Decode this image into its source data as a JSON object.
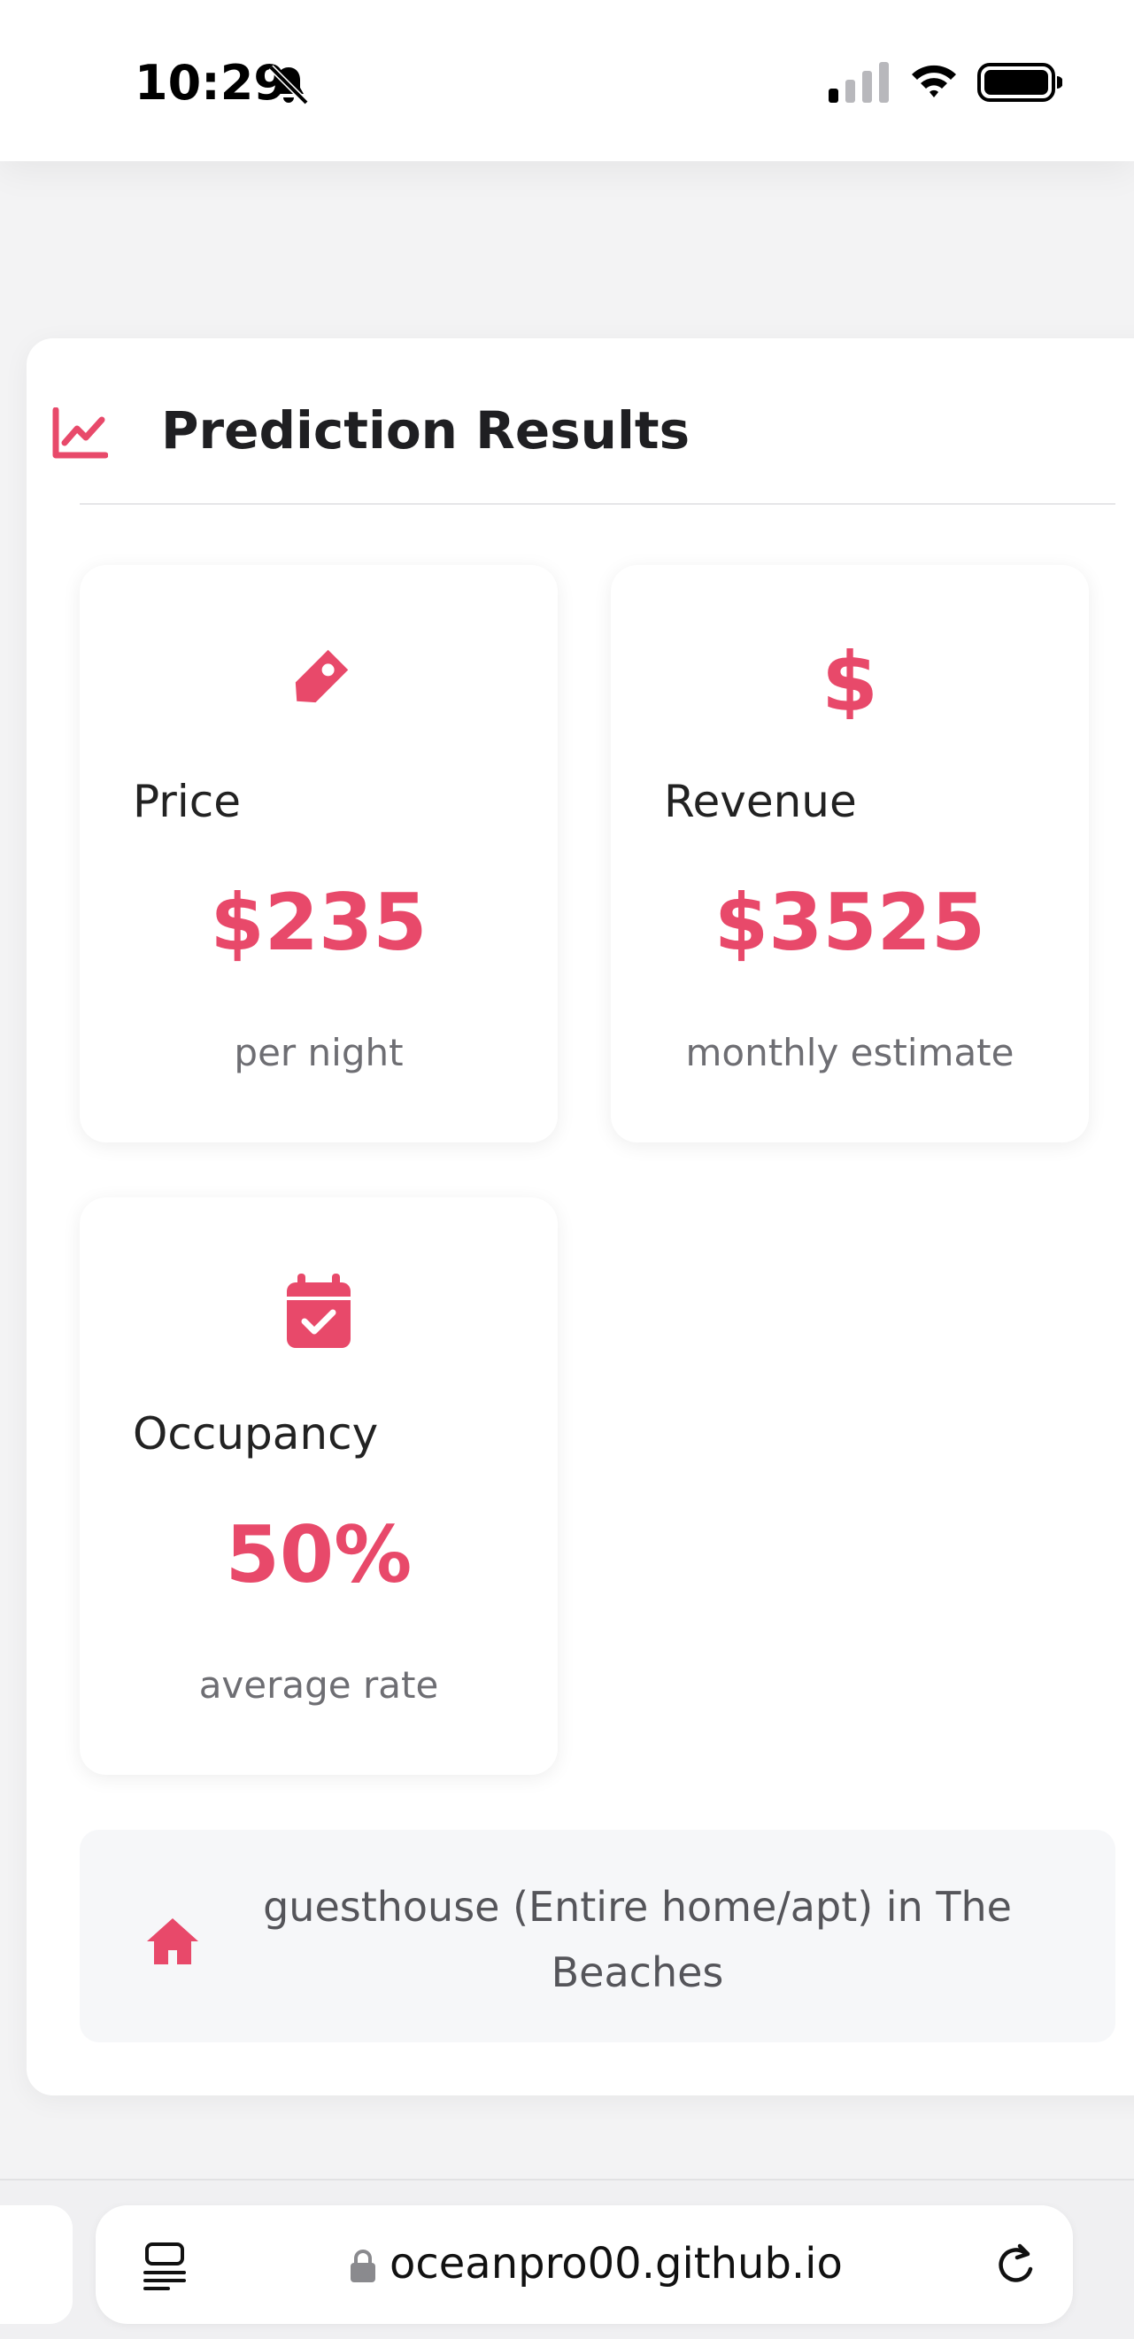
{
  "status_bar": {
    "time": "10:29",
    "icons": [
      "bell-slash-icon",
      "signal-icon",
      "wifi-icon",
      "battery-icon"
    ]
  },
  "results": {
    "title": "Prediction Results",
    "title_icon": "chart-line-icon",
    "accent_color": "#e8496a",
    "metrics": [
      {
        "icon": "tag-icon",
        "label": "Price",
        "value": "$235",
        "sub": "per night"
      },
      {
        "icon": "dollar-icon",
        "label": "Revenue",
        "value": "$3525",
        "sub": "monthly estimate"
      },
      {
        "icon": "calendar-check-icon",
        "label": "Occupancy",
        "value": "50%",
        "sub": "average rate"
      }
    ],
    "location": {
      "icon": "home-icon",
      "text": "guesthouse (Entire home/apt) in The Beaches"
    }
  },
  "browser": {
    "url": "oceanpro00.github.io",
    "icons": [
      "tabs-icon",
      "lock-icon",
      "reload-icon"
    ]
  }
}
